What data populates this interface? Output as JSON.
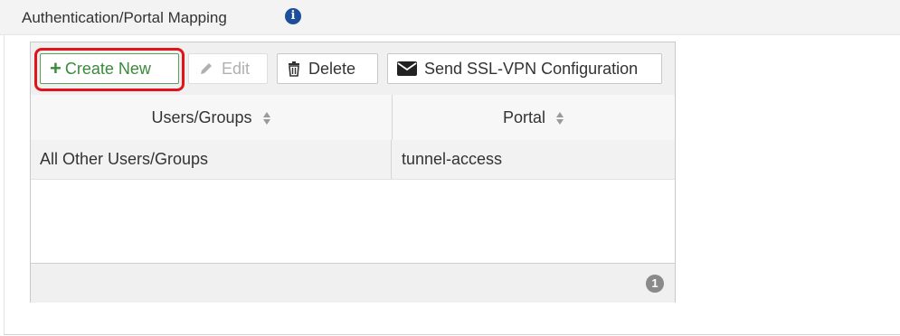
{
  "section": {
    "title": "Authentication/Portal Mapping",
    "info_icon": "info-circle-icon"
  },
  "toolbar": {
    "create_label": "Create New",
    "edit_label": "Edit",
    "delete_label": "Delete",
    "send_label": "Send SSL-VPN Configuration",
    "create_icon": "plus-icon",
    "edit_icon": "pencil-icon",
    "delete_icon": "trash-icon",
    "send_icon": "envelope-icon"
  },
  "table": {
    "columns": [
      "Users/Groups",
      "Portal"
    ],
    "rows": [
      {
        "users_groups": "All Other Users/Groups",
        "portal": "tunnel-access"
      }
    ],
    "row_count": "1"
  },
  "colors": {
    "create_accent": "#3a8a3a",
    "highlight": "#e0141a",
    "info_icon": "#1b4e9b"
  }
}
